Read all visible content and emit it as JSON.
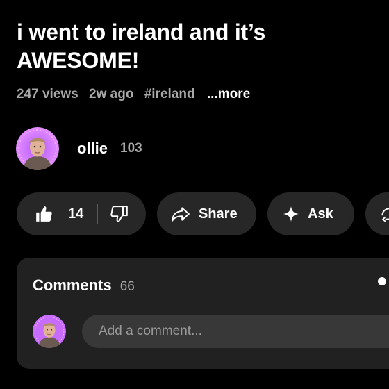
{
  "video": {
    "title": "i went to ireland and it’s AWESOME!",
    "views": "247 views",
    "age": "2w ago",
    "hashtag": "#ireland",
    "more_label": "...more"
  },
  "channel": {
    "name": "ollie",
    "subscriber_count": "103"
  },
  "actions": {
    "like_count": "14",
    "share_label": "Share",
    "ask_label": "Ask"
  },
  "comments": {
    "title": "Comments",
    "count": "66",
    "input_placeholder": "Add a comment..."
  },
  "icons": {
    "like": "thumbs-up-icon",
    "dislike": "thumbs-down-icon",
    "share": "share-arrow-icon",
    "ask": "sparkle-icon",
    "extra": "remix-icon"
  },
  "colors": {
    "background": "#000000",
    "pill": "#272727",
    "panel": "#212121",
    "input": "#383838",
    "muted_text": "#a8a8a8",
    "avatar_ring": "#c86cff"
  }
}
